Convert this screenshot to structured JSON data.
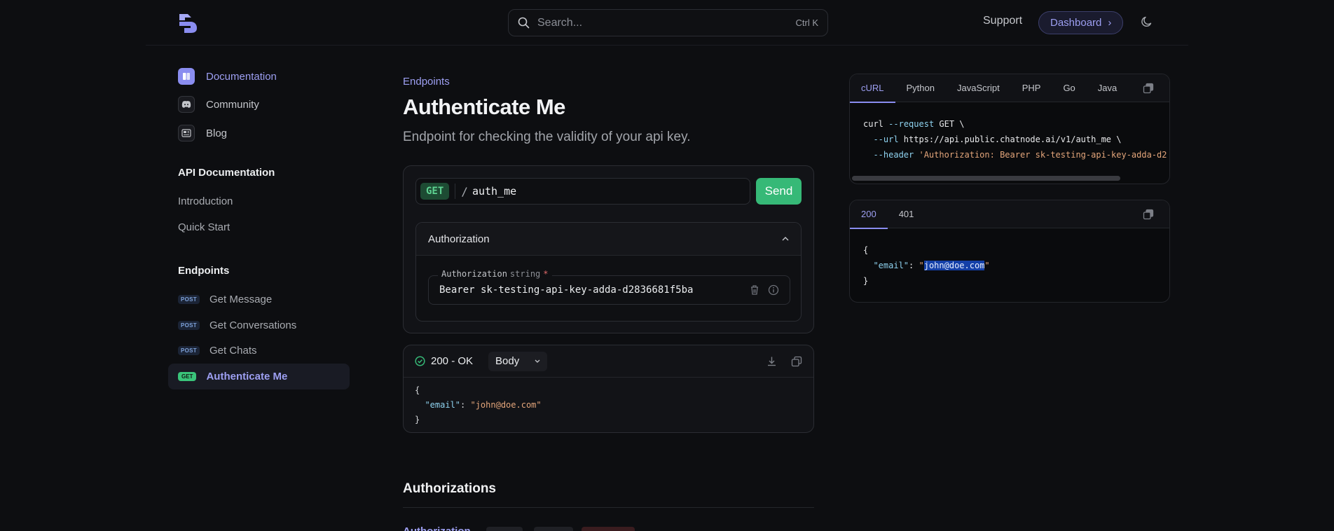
{
  "header": {
    "search_placeholder": "Search...",
    "search_shortcut": "Ctrl K",
    "support_label": "Support",
    "dashboard_label": "Dashboard",
    "dashboard_chevron": "›"
  },
  "sidebar": {
    "top_items": [
      {
        "label": "Documentation",
        "icon": "book-icon",
        "active": true
      },
      {
        "label": "Community",
        "icon": "discord-icon",
        "active": false
      },
      {
        "label": "Blog",
        "icon": "newspaper-icon",
        "active": false
      }
    ],
    "api_heading": "API Documentation",
    "api_links": [
      "Introduction",
      "Quick Start"
    ],
    "endpoints_heading": "Endpoints",
    "endpoints": [
      {
        "method": "POST",
        "label": "Get Message"
      },
      {
        "method": "POST",
        "label": "Get Conversations"
      },
      {
        "method": "POST",
        "label": "Get Chats"
      },
      {
        "method": "GET",
        "label": "Authenticate Me",
        "active": true
      }
    ]
  },
  "main": {
    "breadcrumb": "Endpoints",
    "title": "Authenticate Me",
    "subtitle": "Endpoint for checking the validity of your api key.",
    "request": {
      "method": "GET",
      "slash": "/",
      "path": "auth_me",
      "send_label": "Send",
      "auth_section_label": "Authorization",
      "auth_field_label": "Authorization",
      "auth_field_type": "string",
      "auth_field_required": "*",
      "auth_field_value": "Bearer sk-testing-api-key-adda-d2836681f5ba"
    },
    "response": {
      "status": "200 - OK",
      "view_select": "Body",
      "lines": [
        "{",
        "\"email\"",
        ": ",
        "\"john@doe.com\"",
        "}"
      ]
    },
    "authorizations_title": "Authorizations",
    "authorizations_param": "Authorization"
  },
  "code_panel": {
    "tabs": [
      "cURL",
      "Python",
      "JavaScript",
      "PHP",
      "Go",
      "Java"
    ],
    "active_tab": "cURL",
    "line1_cmd": "curl",
    "line1_flag": "--request",
    "line1_rest": " GET \\",
    "line2_flag": "--url",
    "line2_rest": " https://api.public.chatnode.ai/v1/auth_me \\",
    "line3_flag": "--header",
    "line3_str": "'Authorization: Bearer sk-testing-api-key-adda-d2"
  },
  "response_panel": {
    "tabs": [
      "200",
      "401"
    ],
    "active_tab": "200",
    "open": "{",
    "key": "\"email\"",
    "colon": ": ",
    "q": "\"",
    "value": "john@doe.com",
    "close": "}"
  },
  "colors": {
    "accent": "#9d9ff2",
    "success": "#36b977",
    "background": "#0d0e11"
  }
}
